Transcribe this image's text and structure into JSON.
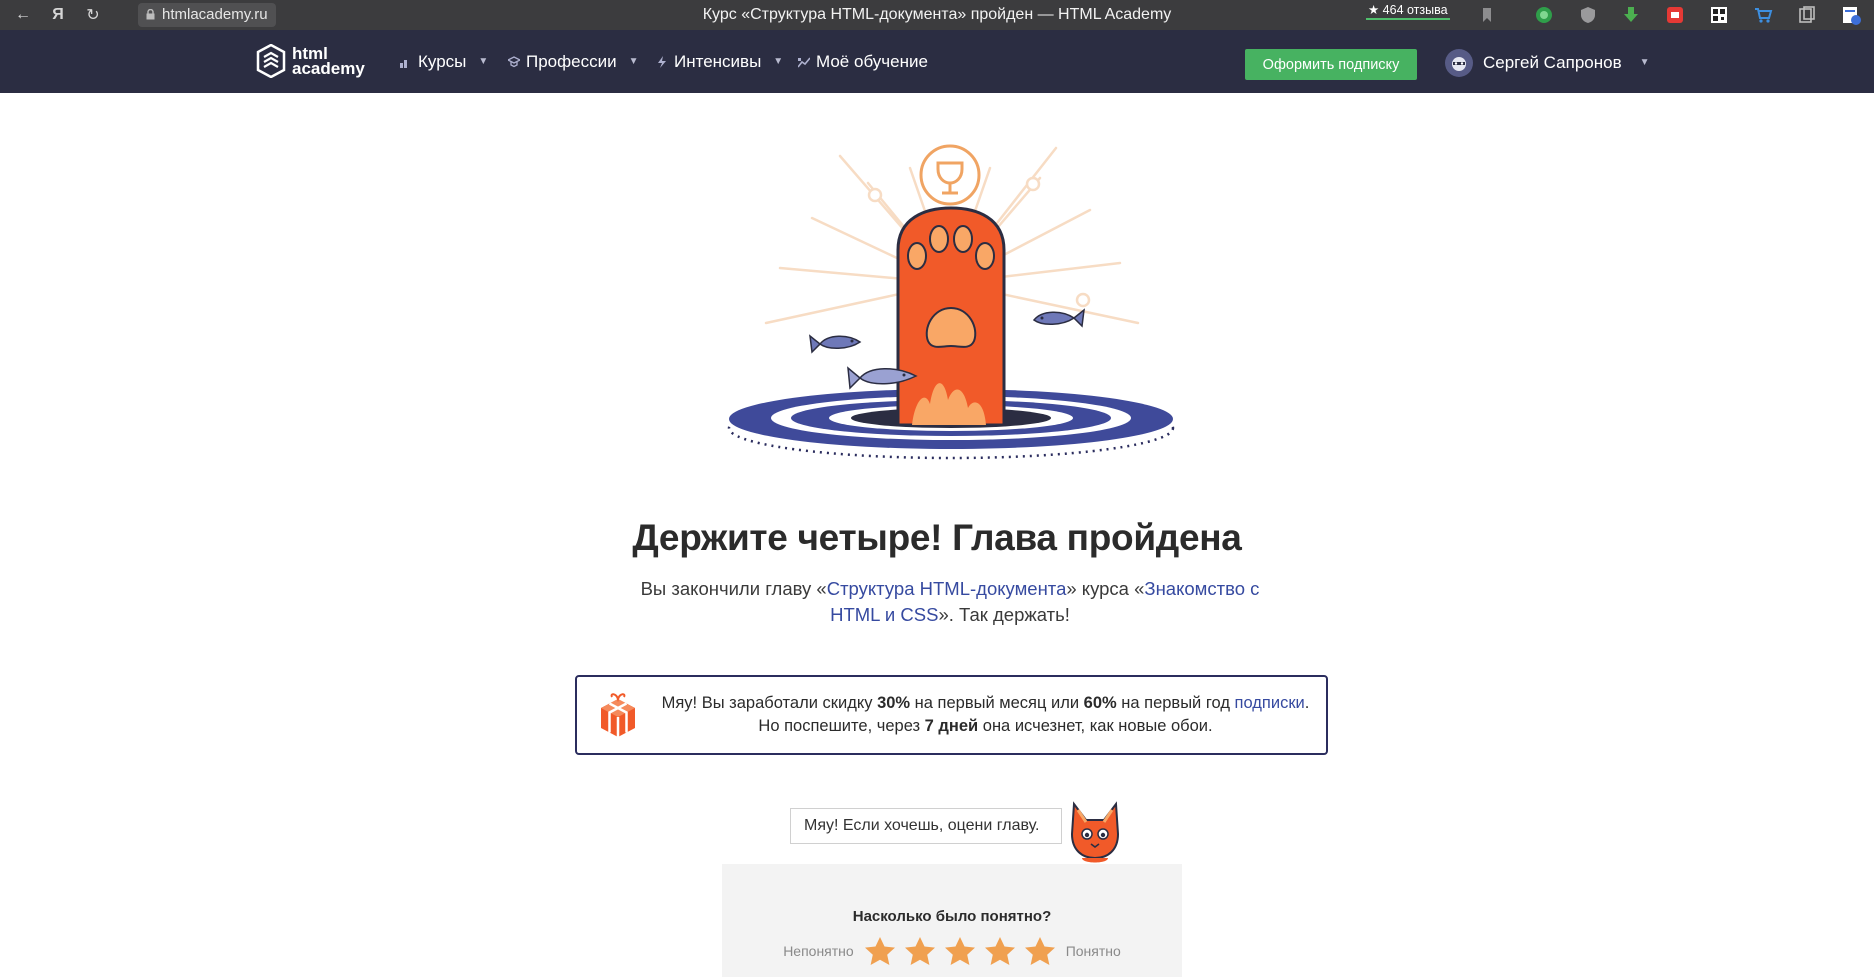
{
  "browser": {
    "url": "htmlacademy.ru",
    "tab_title": "Курс «Структура HTML-документа» пройден — HTML Academy",
    "reviews_label": "★ 464 отзыва",
    "search_engine_glyph": "Я"
  },
  "header": {
    "logo_line1": "html",
    "logo_line2": "academy",
    "nav": [
      {
        "label": "Курсы"
      },
      {
        "label": "Профессии"
      },
      {
        "label": "Интенсивы"
      },
      {
        "label": "Моё обучение"
      }
    ],
    "subscribe_label": "Оформить подписку",
    "user_name": "Сергей Сапронов"
  },
  "hero": {
    "heading": "Держите четыре! Глава пройдена",
    "text_before": "Вы закончили главу «",
    "chapter_link": "Структура HTML-документа",
    "text_middle": "» курса «",
    "course_link": "Знакомство с HTML и CSS",
    "text_after": "». Так держать!"
  },
  "discount": {
    "part1": "Мяу! Вы заработали скидку ",
    "pct1": "30%",
    "part2": " на первый месяц или ",
    "pct2": "60%",
    "part3": " на первый год ",
    "link": "подписки",
    "part4": ".",
    "part5": "Но поспешите, через ",
    "days": "7 дней",
    "part6": " она исчезнет, как новые обои."
  },
  "rating": {
    "bubble": "Мяу! Если хочешь, оцени главу.",
    "question": "Насколько было понятно?",
    "low_label": "Непонятно",
    "high_label": "Понятно",
    "star_count": 5
  },
  "colors": {
    "header_bg": "#2b2d42",
    "accent_green": "#47b261",
    "link_blue": "#364aa0",
    "paw_orange": "#f15a29",
    "star_orange": "#f0a050"
  }
}
